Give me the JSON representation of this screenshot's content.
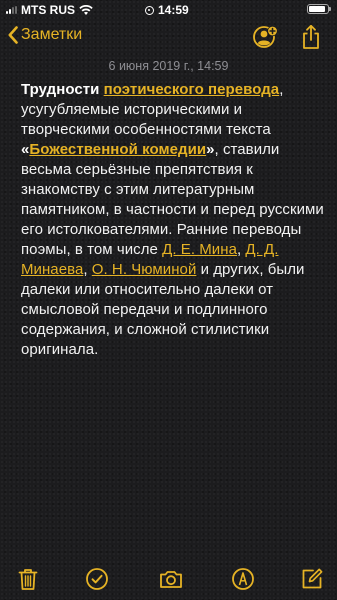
{
  "status_bar": {
    "carrier": "MTS RUS",
    "time": "14:59",
    "signal_bars_active": 2,
    "signal_bars_total": 4,
    "battery_level": 0.9
  },
  "nav": {
    "back_label": "Заметки",
    "accent_color": "#e6b325"
  },
  "note": {
    "timestamp": "6 июня 2019 г., 14:59",
    "segments": [
      {
        "text": "Трудности",
        "style": "bold"
      },
      {
        "text": " ",
        "style": "plain"
      },
      {
        "text": "поэтического перевода",
        "style": "bold-link"
      },
      {
        "text": ", усугубляемые историческими и творческими особенностями текста ",
        "style": "plain"
      },
      {
        "text": "«",
        "style": "bold"
      },
      {
        "text": "Божественной комедии",
        "style": "bold-link"
      },
      {
        "text": "»",
        "style": "bold"
      },
      {
        "text": ", ставили весьма серьёзные препятствия к знакомству с этим литературным памятником, в частности и перед русскими его истолкователями. Ранние переводы поэмы, в том числе ",
        "style": "plain"
      },
      {
        "text": "Д. Е. Мина",
        "style": "link"
      },
      {
        "text": ", ",
        "style": "plain"
      },
      {
        "text": "Д. Д. Минаева",
        "style": "link"
      },
      {
        "text": ", ",
        "style": "plain"
      },
      {
        "text": "О. Н. Чюминой",
        "style": "link"
      },
      {
        "text": " и других, были далеки или относительно далеки от смысловой передачи и подлинного содержания, и сложной стилистики оригинала.",
        "style": "plain"
      }
    ]
  },
  "toolbar": {
    "icons": [
      "trash-icon",
      "checklist-icon",
      "camera-icon",
      "markup-icon",
      "compose-icon"
    ]
  }
}
